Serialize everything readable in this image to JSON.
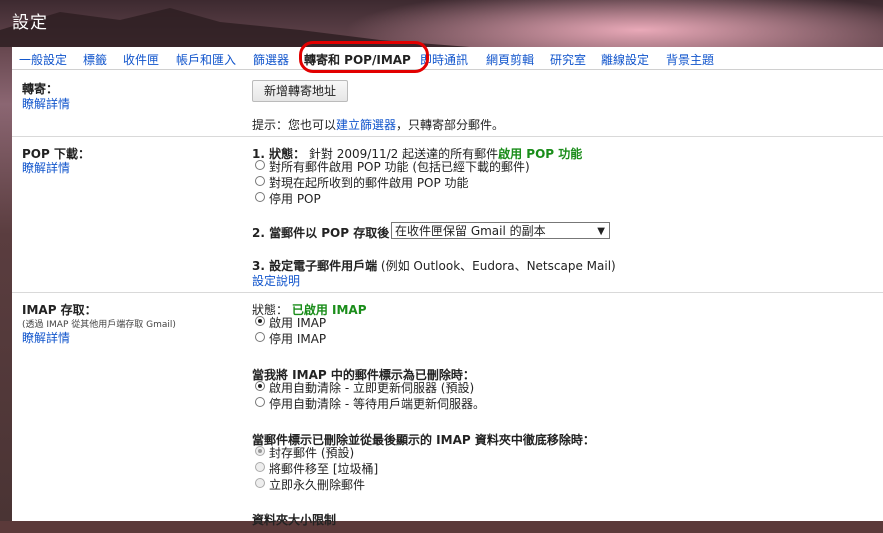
{
  "window": {
    "title": "設定"
  },
  "tabs": [
    {
      "label": "一般設定",
      "active": false
    },
    {
      "label": "標籤",
      "active": false
    },
    {
      "label": "收件匣",
      "active": false
    },
    {
      "label": "帳戶和匯入",
      "active": false
    },
    {
      "label": "篩選器",
      "active": false
    },
    {
      "label": "轉寄和 POP/IMAP",
      "active": true
    },
    {
      "label": "即時通訊",
      "active": false
    },
    {
      "label": "網頁剪輯",
      "active": false
    },
    {
      "label": "研究室",
      "active": false
    },
    {
      "label": "離線設定",
      "active": false
    },
    {
      "label": "背景主題",
      "active": false
    }
  ],
  "forwarding": {
    "label": "轉寄：",
    "learn_more": "瞭解詳情",
    "add_button": "新增轉寄地址",
    "tip_prefix": "提示：您也可以",
    "tip_link": "建立篩選器",
    "tip_suffix": "，只轉寄部分郵件。"
  },
  "pop": {
    "label": "POP 下載：",
    "learn_more": "瞭解詳情",
    "status_prefix": "1. 狀態：",
    "status_text": "針對 2009/11/2 起送達的所有郵件",
    "status_enabled": "啟用 POP 功能",
    "options": [
      {
        "label": "對所有郵件啟用 POP 功能 (包括已經下載的郵件)",
        "selected": false
      },
      {
        "label": "對現在起所收到的郵件啟用 POP 功能",
        "selected": false
      },
      {
        "label": "停用 POP",
        "selected": false
      }
    ],
    "step2_label": "2. 當郵件以 POP 存取後",
    "step2_select": "在收件匣保留 Gmail 的副本",
    "step3_prefix": "3. 設定電子郵件用戶端",
    "step3_text": "(例如 Outlook、Eudora、Netscape Mail)",
    "step3_link": "設定說明"
  },
  "imap": {
    "label": "IMAP 存取：",
    "sublabel": "(透過 IMAP 從其他用戶端存取 Gmail)",
    "learn_more": "瞭解詳情",
    "status_prefix": "狀態：",
    "status_value": "已啟用 IMAP",
    "enable_options": [
      {
        "label": "啟用 IMAP",
        "selected": true
      },
      {
        "label": "停用 IMAP",
        "selected": false
      }
    ],
    "delete_heading": "當我將 IMAP 中的郵件標示為已刪除時：",
    "delete_options": [
      {
        "label": "啟用自動清除 - 立即更新伺服器 (預設)",
        "selected": true
      },
      {
        "label": "停用自動清除 - 等待用戶端更新伺服器。",
        "selected": false
      }
    ],
    "expunge_heading": "當郵件標示已刪除並從最後顯示的 IMAP 資料夾中徹底移除時：",
    "expunge_options": [
      {
        "label": "封存郵件 (預設)",
        "selected": true
      },
      {
        "label": "將郵件移至 [垃圾桶]",
        "selected": false
      },
      {
        "label": "立即永久刪除郵件",
        "selected": false
      }
    ],
    "folder_size_heading": "資料夾大小限制"
  },
  "colors": {
    "link": "#1155cc",
    "status_green": "#1a8d1a",
    "highlight_circle": "#e20000"
  }
}
